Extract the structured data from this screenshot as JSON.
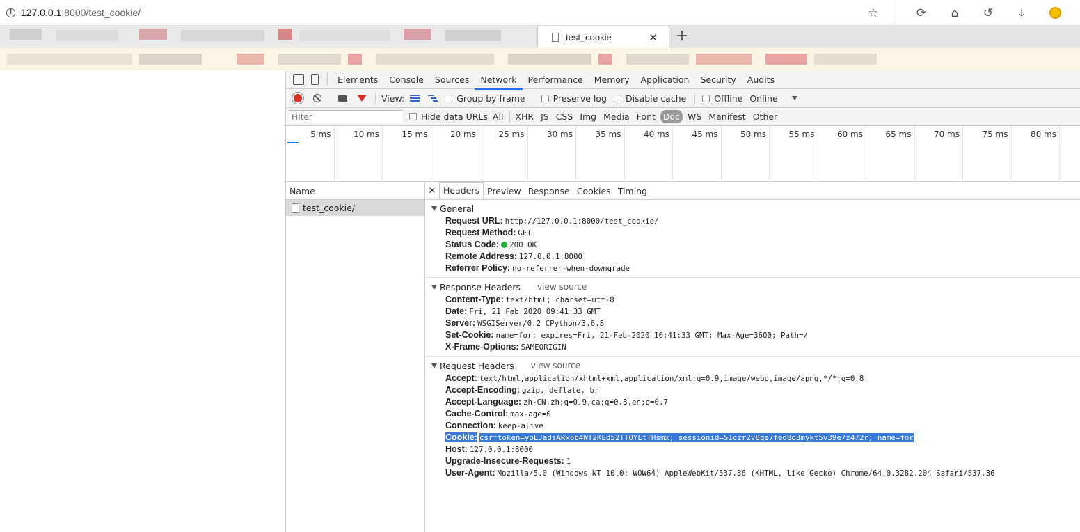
{
  "browser": {
    "url_host": "127.0.0.1",
    "url_rest": ":8000/test_cookie/",
    "tab_title": "test_cookie",
    "icons": [
      "info-icon",
      "star-icon",
      "reload-icon",
      "home-icon",
      "undo-icon",
      "download-icon",
      "avatar"
    ]
  },
  "devtools": {
    "tabs": [
      "Elements",
      "Console",
      "Sources",
      "Network",
      "Performance",
      "Memory",
      "Application",
      "Security",
      "Audits"
    ],
    "active_tab": "Network",
    "toolbar": {
      "view_label": "View:",
      "group_by_frame": "Group by frame",
      "preserve_log": "Preserve log",
      "disable_cache": "Disable cache",
      "offline": "Offline",
      "throttle": "Online"
    },
    "filter": {
      "placeholder": "Filter",
      "hide_data_urls": "Hide data URLs",
      "types": [
        "All",
        "XHR",
        "JS",
        "CSS",
        "Img",
        "Media",
        "Font",
        "Doc",
        "WS",
        "Manifest",
        "Other"
      ],
      "active_type": "Doc"
    },
    "timeline_ticks": [
      "5 ms",
      "10 ms",
      "15 ms",
      "20 ms",
      "25 ms",
      "30 ms",
      "35 ms",
      "40 ms",
      "45 ms",
      "50 ms",
      "55 ms",
      "60 ms",
      "65 ms",
      "70 ms",
      "75 ms",
      "80 ms"
    ],
    "name_header": "Name",
    "requests": [
      "test_cookie/"
    ],
    "detail_tabs": [
      "Headers",
      "Preview",
      "Response",
      "Cookies",
      "Timing"
    ],
    "active_detail_tab": "Headers",
    "view_source": "view source",
    "sections": {
      "general": {
        "title": "General",
        "rows": [
          {
            "k": "Request URL:",
            "v": "http://127.0.0.1:8000/test_cookie/"
          },
          {
            "k": "Request Method:",
            "v": "GET"
          },
          {
            "k": "Status Code:",
            "v": "200 OK"
          },
          {
            "k": "Remote Address:",
            "v": "127.0.0.1:8000"
          },
          {
            "k": "Referrer Policy:",
            "v": "no-referrer-when-downgrade"
          }
        ]
      },
      "response": {
        "title": "Response Headers",
        "rows": [
          {
            "k": "Content-Type:",
            "v": "text/html; charset=utf-8"
          },
          {
            "k": "Date:",
            "v": "Fri, 21 Feb 2020 09:41:33 GMT"
          },
          {
            "k": "Server:",
            "v": "WSGIServer/0.2 CPython/3.6.8"
          },
          {
            "k": "Set-Cookie:",
            "v": "name=for; expires=Fri, 21-Feb-2020 10:41:33 GMT; Max-Age=3600; Path=/"
          },
          {
            "k": "X-Frame-Options:",
            "v": "SAMEORIGIN"
          }
        ]
      },
      "request": {
        "title": "Request Headers",
        "rows": [
          {
            "k": "Accept:",
            "v": "text/html,application/xhtml+xml,application/xml;q=0.9,image/webp,image/apng,*/*;q=0.8"
          },
          {
            "k": "Accept-Encoding:",
            "v": "gzip, deflate, br"
          },
          {
            "k": "Accept-Language:",
            "v": "zh-CN,zh;q=0.9,ca;q=0.8,en;q=0.7"
          },
          {
            "k": "Cache-Control:",
            "v": "max-age=0"
          },
          {
            "k": "Connection:",
            "v": "keep-alive"
          },
          {
            "k": "Cookie:",
            "v": "csrftoken=yoLJadsARx6b4WT2KEd52TTOYLtTHsmx; sessionid=51czr2v8qe7fed8o3mykt5v39e7z472r; name=for"
          },
          {
            "k": "Host:",
            "v": "127.0.0.1:8000"
          },
          {
            "k": "Upgrade-Insecure-Requests:",
            "v": "1"
          },
          {
            "k": "User-Agent:",
            "v": "Mozilla/5.0 (Windows NT 10.0; WOW64) AppleWebKit/537.36 (KHTML, like Gecko) Chrome/64.0.3282.204 Safari/537.36"
          }
        ]
      }
    }
  }
}
